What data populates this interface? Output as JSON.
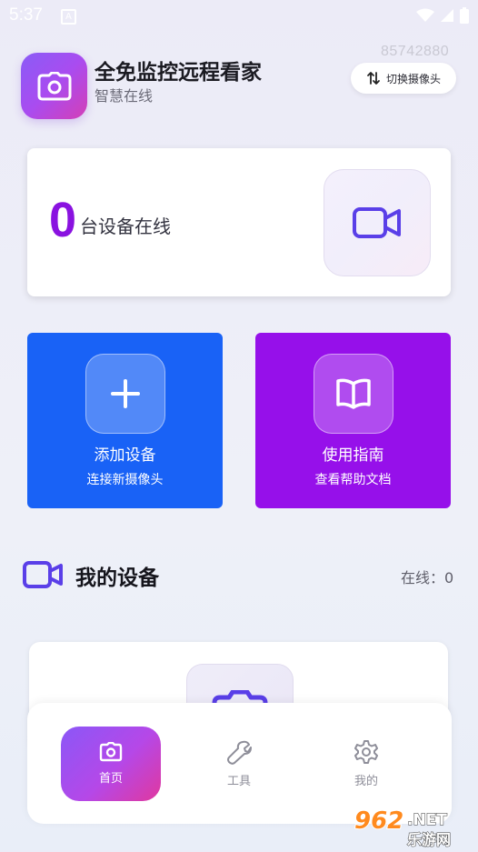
{
  "status_bar": {
    "time": "5:37",
    "notification_glyph": "A"
  },
  "header": {
    "app_title": "全免监控远程看家",
    "app_subtitle": "智慧在线",
    "device_id": "85742880",
    "switch_camera_label": "切换摄像头"
  },
  "online_card": {
    "count": "0",
    "label": "台设备在线"
  },
  "actions": {
    "add": {
      "title": "添加设备",
      "subtitle": "连接新摄像头"
    },
    "guide": {
      "title": "使用指南",
      "subtitle": "查看帮助文档"
    }
  },
  "devices_section": {
    "title": "我的设备",
    "online_text": "在线：0"
  },
  "bottom_nav": {
    "items": [
      {
        "label": "首页"
      },
      {
        "label": "工具"
      },
      {
        "label": "我的"
      }
    ]
  },
  "watermark": {
    "number": "962",
    "suffix": ".NET",
    "site": "乐游网"
  },
  "colors": {
    "accent_blue": "#1962f6",
    "accent_purple": "#9610ea",
    "count_purple": "#8a12e0",
    "icon_indigo": "#5a3fe8"
  }
}
